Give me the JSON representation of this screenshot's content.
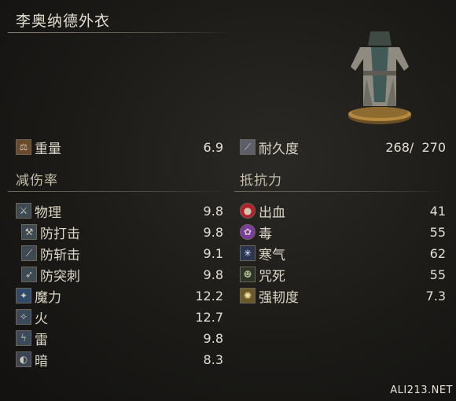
{
  "item": {
    "name": "李奥纳德外衣"
  },
  "weight": {
    "label": "重量",
    "value": "6.9"
  },
  "durability": {
    "label": "耐久度",
    "value": "268/  270"
  },
  "absorption": {
    "header": "减伤率",
    "rows": [
      {
        "label": "物理",
        "value": "9.8",
        "icon": "physical-icon"
      },
      {
        "label": "防打击",
        "value": "9.8",
        "icon": "strike-icon"
      },
      {
        "label": "防斩击",
        "value": "9.1",
        "icon": "slash-icon"
      },
      {
        "label": "防突刺",
        "value": "9.8",
        "icon": "thrust-icon"
      },
      {
        "label": "魔力",
        "value": "12.2",
        "icon": "magic-icon"
      },
      {
        "label": "火",
        "value": "12.7",
        "icon": "fire-icon"
      },
      {
        "label": "雷",
        "value": "9.8",
        "icon": "lightning-icon"
      },
      {
        "label": "暗",
        "value": "8.3",
        "icon": "dark-icon"
      }
    ]
  },
  "resistance": {
    "header": "抵抗力",
    "rows": [
      {
        "label": "出血",
        "value": "41",
        "icon": "bleed-icon",
        "color": "#b3202a"
      },
      {
        "label": "毒",
        "value": "55",
        "icon": "poison-icon",
        "color": "#7a3aa0"
      },
      {
        "label": "寒气",
        "value": "62",
        "icon": "frost-icon",
        "color": "#a9c6ec"
      },
      {
        "label": "咒死",
        "value": "55",
        "icon": "curse-icon",
        "color": "#4b5a3e"
      },
      {
        "label": "强韧度",
        "value": "7.3",
        "icon": "poise-icon",
        "color": "#d7c67a"
      }
    ]
  },
  "watermark": "ALI213.NET",
  "colors": {
    "background": "#1b1a17",
    "text": "#d9d4c7",
    "line": "#8c8372"
  }
}
